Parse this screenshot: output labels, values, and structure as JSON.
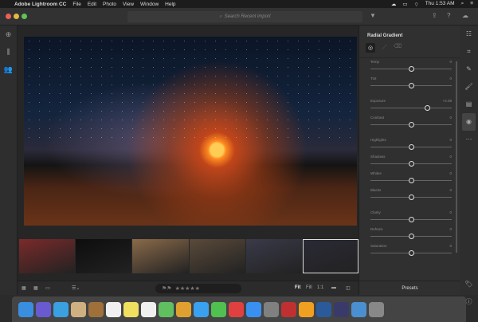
{
  "menubar": {
    "app": "Adobe Lightroom CC",
    "items": [
      "File",
      "Edit",
      "Photo",
      "View",
      "Window",
      "Help"
    ],
    "clock": "Thu 1:53 AM"
  },
  "titlebar": {
    "search_placeholder": "Search Recent import"
  },
  "panel": {
    "title": "Radial Gradient",
    "sliders": [
      {
        "label": "Temp",
        "value": "0",
        "position": 0.5
      },
      {
        "label": "Tint",
        "value": "0",
        "position": 0.5
      },
      {
        "label": "Exposure",
        "value": "+2.08",
        "position": 0.7
      },
      {
        "label": "Contrast",
        "value": "0",
        "position": 0.5
      },
      {
        "label": "Highlights",
        "value": "0",
        "position": 0.5
      },
      {
        "label": "Shadows",
        "value": "0",
        "position": 0.5
      },
      {
        "label": "Whites",
        "value": "0",
        "position": 0.5
      },
      {
        "label": "Blacks",
        "value": "0",
        "position": 0.5
      },
      {
        "label": "Clarity",
        "value": "0",
        "position": 0.5
      },
      {
        "label": "Dehaze",
        "value": "0",
        "position": 0.5
      },
      {
        "label": "Saturation",
        "value": "0",
        "position": 0.5
      }
    ],
    "presets_label": "Presets"
  },
  "bottombar": {
    "fit": "Fit",
    "fill": "Fill",
    "one_to_one": "1:1",
    "stars": "★★★★★"
  },
  "filmstrip": {
    "thumb_colors": [
      "#7a2a2a",
      "#0d0d0d",
      "#8a6a4a",
      "#5a4a3a",
      "#3a3a4a",
      "#2a2a35"
    ],
    "selected_index": 5
  },
  "dock": {
    "icon_colors": [
      "#3a8ee0",
      "#6a5ad0",
      "#3aa0e0",
      "#d0b080",
      "#a0703a",
      "#f0f0f0",
      "#f0e060",
      "#f0f0f0",
      "#60c060",
      "#e0a030",
      "#3aa0f0",
      "#50c050",
      "#e04040",
      "#3a90f0",
      "#808080",
      "#c03030",
      "#f0a020",
      "#2a5a9a",
      "#3a3a6a",
      "#4a90d0",
      "#888888"
    ]
  }
}
